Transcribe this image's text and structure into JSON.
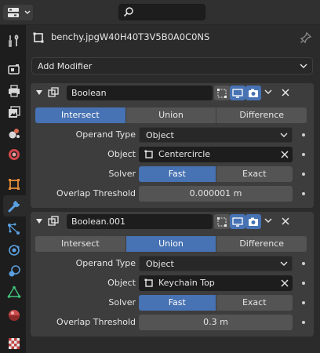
{
  "header": {
    "editor_type_icon": "properties-editor-icon",
    "search_icon": "search-icon"
  },
  "tabs": [
    {
      "name": "tool-tab",
      "icon": "wrench-screwdriver-icon"
    },
    {
      "name": "render-tab",
      "icon": "camera-back-icon"
    },
    {
      "name": "output-tab",
      "icon": "printer-icon"
    },
    {
      "name": "view-layer-tab",
      "icon": "image-stack-icon"
    },
    {
      "name": "scene-tab",
      "icon": "scene-icon"
    },
    {
      "name": "world-tab",
      "icon": "world-icon"
    },
    {
      "name": "object-tab",
      "icon": "object-square-icon"
    },
    {
      "name": "modifiers-tab",
      "icon": "wrench-icon",
      "active": true
    },
    {
      "name": "particles-tab",
      "icon": "particles-icon"
    },
    {
      "name": "physics-tab",
      "icon": "physics-orbit-icon"
    },
    {
      "name": "constraints-tab",
      "icon": "constraint-icon"
    },
    {
      "name": "object-data-tab",
      "icon": "mesh-triangle-icon"
    },
    {
      "name": "material-tab",
      "icon": "material-sphere-icon"
    },
    {
      "name": "texture-tab",
      "icon": "texture-checker-icon"
    }
  ],
  "object": {
    "name": "benchy.jpgW40H40T3V5B0A0C0NS"
  },
  "add_modifier_label": "Add Modifier",
  "modifiers": [
    {
      "name": "Boolean",
      "operations": [
        "Intersect",
        "Union",
        "Difference"
      ],
      "active_operation": "Intersect",
      "operand_type_label": "Operand Type",
      "operand_type_value": "Object",
      "object_label": "Object",
      "object_value": "Centercircle",
      "solver_label": "Solver",
      "solver_options": [
        "Fast",
        "Exact"
      ],
      "solver_active": "Fast",
      "overlap_label": "Overlap Threshold",
      "overlap_value": "0.000001 m"
    },
    {
      "name": "Boolean.001",
      "operations": [
        "Intersect",
        "Union",
        "Difference"
      ],
      "active_operation": "Union",
      "operand_type_label": "Operand Type",
      "operand_type_value": "Object",
      "object_label": "Object",
      "object_value": "Keychain Top",
      "solver_label": "Solver",
      "solver_options": [
        "Fast",
        "Exact"
      ],
      "solver_active": "Fast",
      "overlap_label": "Overlap Threshold",
      "overlap_value": "0.3 m"
    }
  ],
  "colors": {
    "accent": "#4772b3",
    "panel": "#3d3d3d",
    "background": "#2b2b2b",
    "tabbar": "#1d1d1d"
  }
}
